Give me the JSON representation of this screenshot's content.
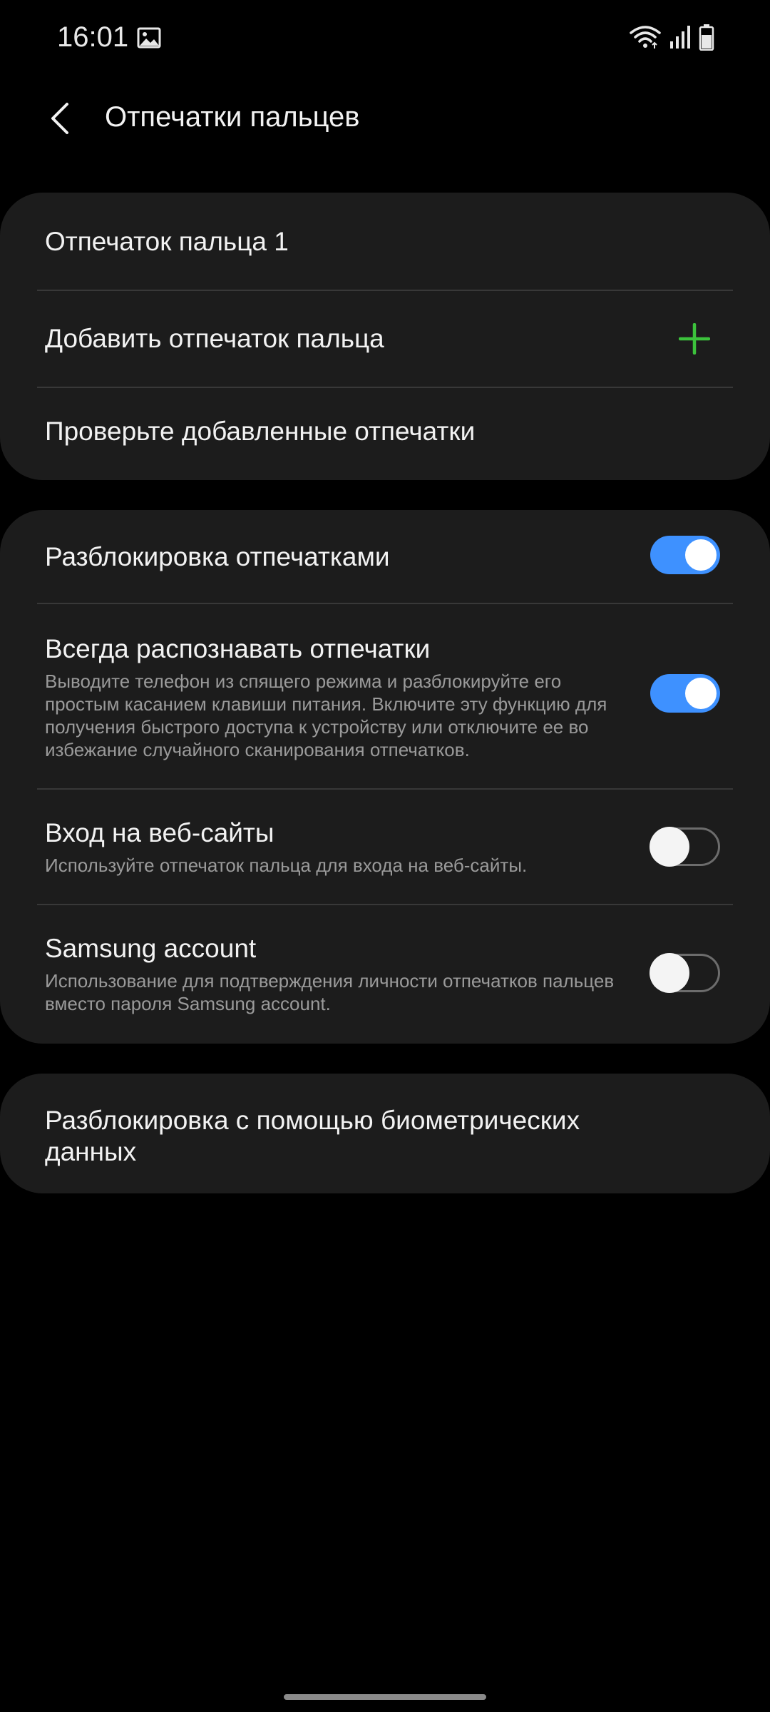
{
  "status_bar": {
    "time": "16:01",
    "icons": [
      "gallery-icon",
      "wifi-icon",
      "signal-icon",
      "battery-icon"
    ]
  },
  "header": {
    "title": "Отпечатки пальцев",
    "back_icon": "back-arrow-icon"
  },
  "fingerprints_card": {
    "fingerprint_1": "Отпечаток пальца 1",
    "add_fingerprint": "Добавить отпечаток пальца",
    "check_fingerprints": "Проверьте добавленные отпечатки"
  },
  "settings_card": {
    "fingerprint_unlock": {
      "title": "Разблокировка отпечатками",
      "enabled": true
    },
    "always_on": {
      "title": "Всегда распознавать отпечатки",
      "description": "Выводите телефон из спящего режима и разблокируйте его простым касанием клавиши питания. Включите эту функцию для получения быстрого доступа к устройству или отключите ее во избежание случайного сканирования отпечатков.",
      "enabled": true
    },
    "web_signin": {
      "title": "Вход на веб-сайты",
      "description": "Используйте отпечаток пальца для входа на веб-сайты.",
      "enabled": false
    },
    "samsung_account": {
      "title": "Samsung account",
      "description": "Использование для подтверждения личности отпечатков пальцев вместо пароля Samsung account.",
      "enabled": false
    }
  },
  "biometrics_card": {
    "title": "Разблокировка с помощью биометрических данных"
  },
  "colors": {
    "background": "#000000",
    "card": "#1c1c1c",
    "accent_toggle": "#3e91ff",
    "plus_icon": "#3cc23c"
  }
}
